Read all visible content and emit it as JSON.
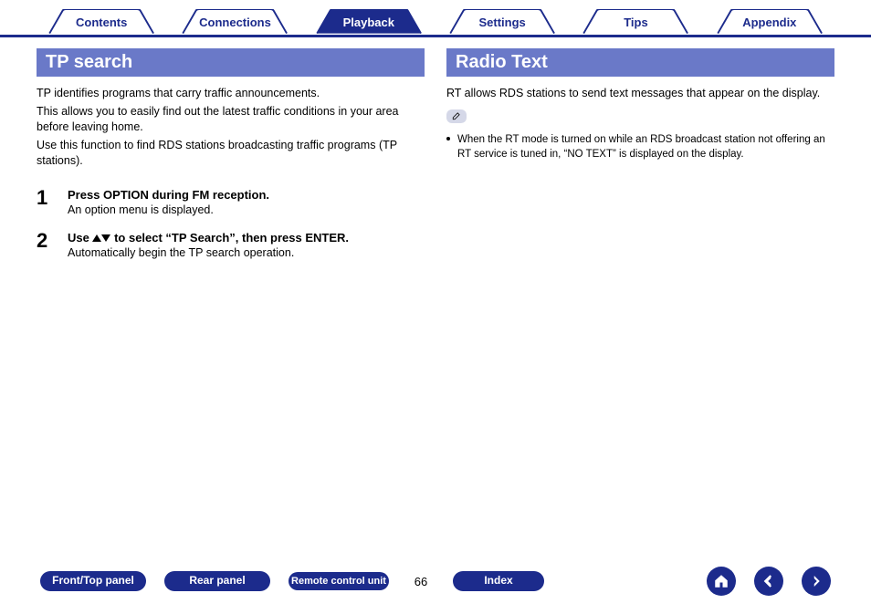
{
  "tabs": [
    {
      "label": "Contents",
      "active": false
    },
    {
      "label": "Connections",
      "active": false
    },
    {
      "label": "Playback",
      "active": true
    },
    {
      "label": "Settings",
      "active": false
    },
    {
      "label": "Tips",
      "active": false
    },
    {
      "label": "Appendix",
      "active": false
    }
  ],
  "left": {
    "title": "TP search",
    "paragraphs": [
      "TP identifies programs that carry traffic announcements.",
      "This allows you to easily find out the latest traffic conditions in your area before leaving home.",
      "Use this function to find RDS stations broadcasting traffic programs (TP stations)."
    ],
    "steps": [
      {
        "num": "1",
        "head": "Press OPTION during FM reception.",
        "sub": "An option menu is displayed."
      },
      {
        "num": "2",
        "head_prefix": "Use ",
        "head_suffix": " to select “TP Search”, then press ENTER.",
        "sub": "Automatically begin the TP search operation."
      }
    ]
  },
  "right": {
    "title": "Radio Text",
    "paragraphs": [
      "RT allows RDS stations to send text messages that appear on the display."
    ],
    "note_bullets": [
      "When the RT mode is turned on while an RDS broadcast station not offering an RT service is tuned in, “NO TEXT” is displayed on the display."
    ]
  },
  "bottom": {
    "buttons": [
      "Front/Top panel",
      "Rear panel",
      "Remote control unit"
    ],
    "page": "66",
    "index_label": "Index"
  }
}
